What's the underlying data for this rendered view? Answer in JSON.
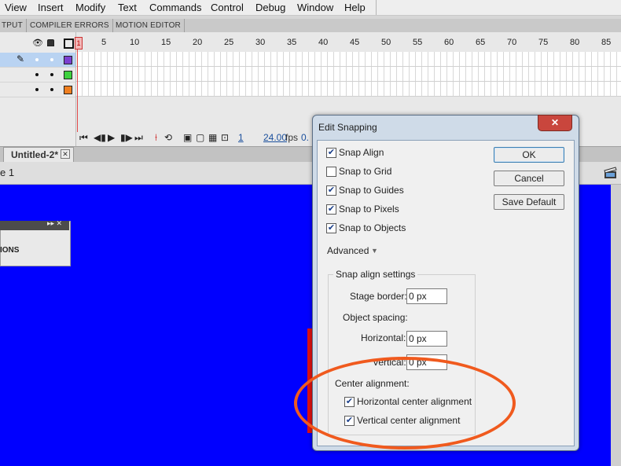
{
  "menu": [
    "View",
    "Insert",
    "Modify",
    "Text",
    "Commands",
    "Control",
    "Debug",
    "Window",
    "Help"
  ],
  "panel_tabs": [
    "TPUT",
    "COMPILER ERRORS",
    "MOTION EDITOR"
  ],
  "timeline": {
    "ruler": [
      "1",
      "5",
      "10",
      "15",
      "20",
      "25",
      "30",
      "35",
      "40",
      "45",
      "50",
      "55",
      "60",
      "65",
      "70",
      "75",
      "80",
      "85"
    ],
    "layers": [
      {
        "color": "#7b3fd1"
      },
      {
        "color": "#3ed13e"
      },
      {
        "color": "#f07f20"
      }
    ],
    "current_frame": "1",
    "fps": "24.00",
    "fps_label": "fps",
    "time_value": "0."
  },
  "document": {
    "tab_label": "Untitled-2*",
    "close_glyph": "✕",
    "scene_label": "e 1",
    "panel_text": "IONS",
    "panel_btns": "▸▸ ✕"
  },
  "dialog": {
    "title": "Edit Snapping",
    "close_glyph": "✕",
    "checkboxes": [
      {
        "label": "Snap Align",
        "checked": true
      },
      {
        "label": "Snap to Grid",
        "checked": false
      },
      {
        "label": "Snap to Guides",
        "checked": true
      },
      {
        "label": "Snap to Pixels",
        "checked": true
      },
      {
        "label": "Snap to Objects",
        "checked": true
      }
    ],
    "buttons": {
      "ok": "OK",
      "cancel": "Cancel",
      "default": "Save Default"
    },
    "advanced": "Advanced",
    "group_title": "Snap align settings",
    "stage_border_label": "Stage border:",
    "stage_border_value": "0 px",
    "object_spacing_label": "Object spacing:",
    "horizontal_label": "Horizontal:",
    "horizontal_value": "0 px",
    "vertical_label": "Vertical:",
    "vertical_value": "0 px",
    "center_alignment_label": "Center alignment:",
    "horizontal_center_label": "Horizontal center alignment",
    "vertical_center_label": "Vertical center alignment",
    "horizontal_center_checked": true,
    "vertical_center_checked": true
  },
  "colors": {
    "stage": "#0000ff",
    "annotation": "#f05a1e",
    "guide": "#e01010"
  }
}
